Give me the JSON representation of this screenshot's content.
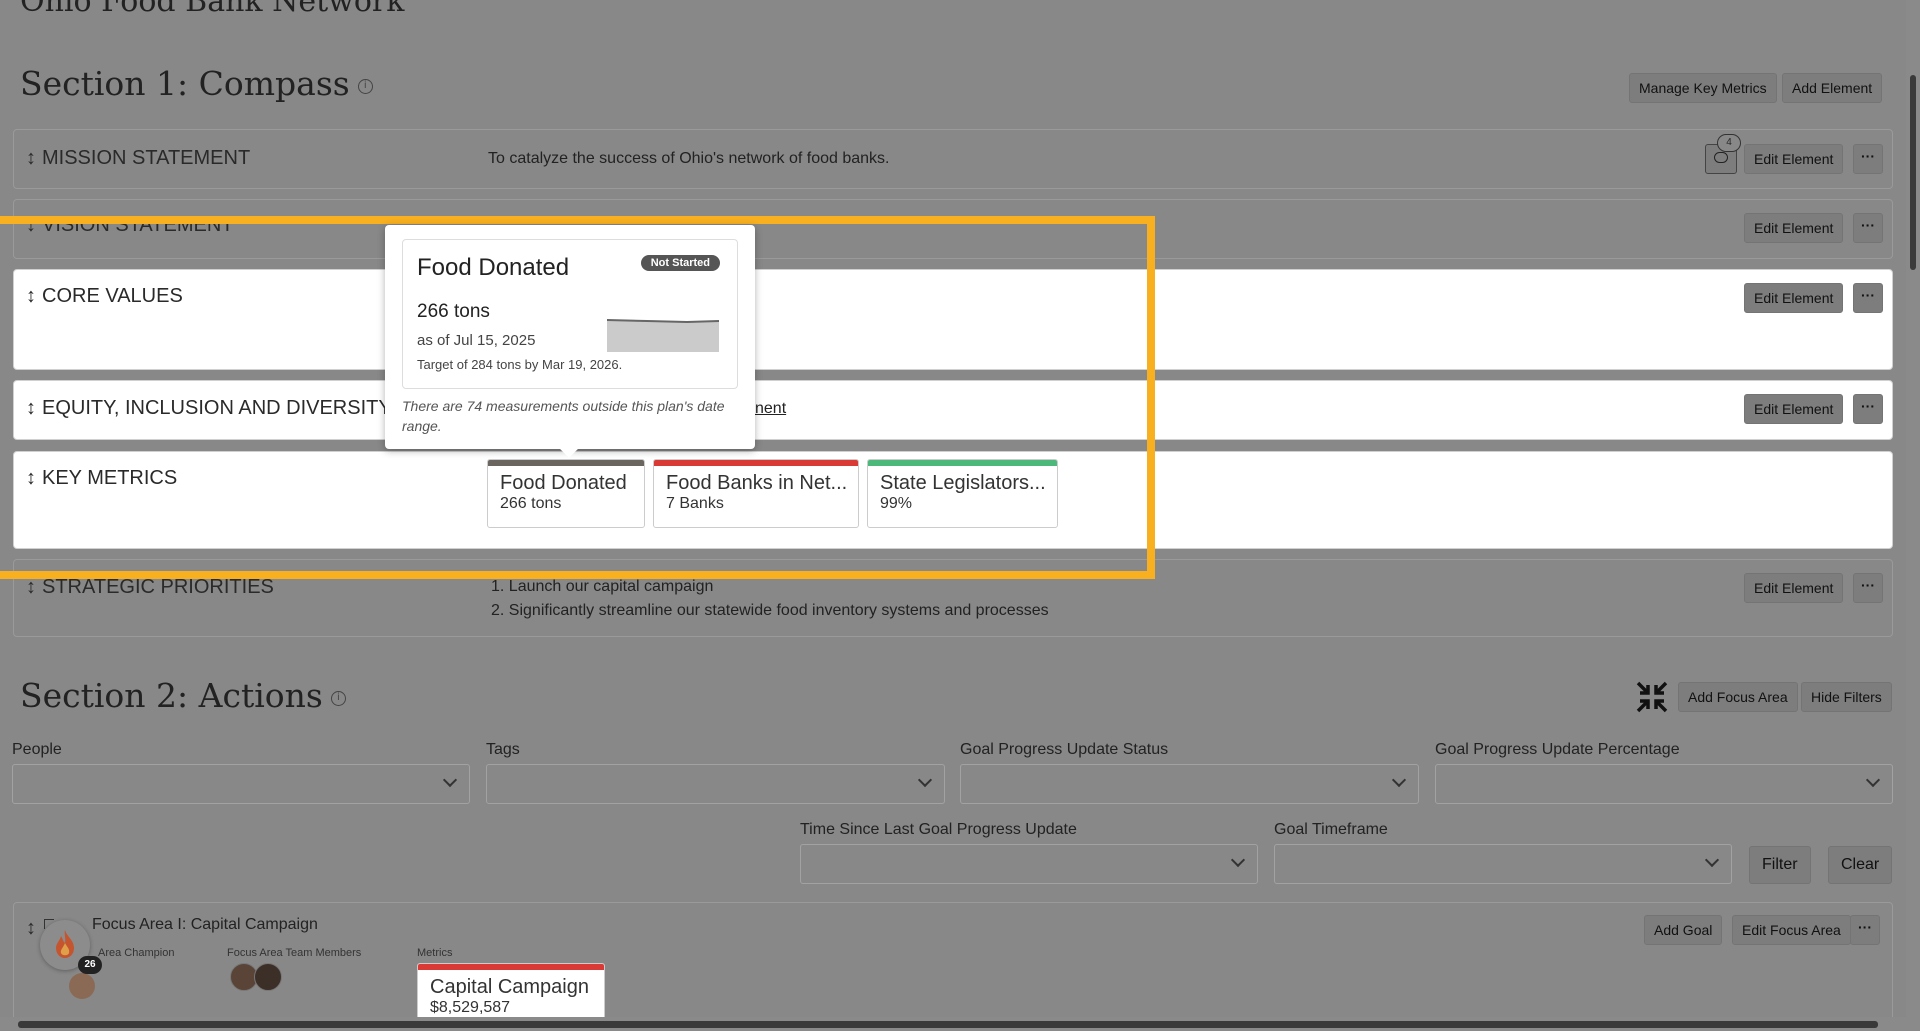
{
  "org": {
    "title": "Ohio Food Bank Network"
  },
  "section1": {
    "title": "Section 1: Compass",
    "info": "i",
    "manage_label": "Manage Key Metrics",
    "add_label": "Add Element"
  },
  "elements": {
    "mission": {
      "arrow": "↕",
      "title": "MISSION STATEMENT",
      "text": "To catalyze the success of Ohio's network of food banks.",
      "comment_count": "4",
      "edit": "Edit Element",
      "more": "···"
    },
    "vision": {
      "arrow": "↕",
      "title": "VISION STATEMENT",
      "edit": "Edit Element",
      "more": "···"
    },
    "core": {
      "arrow": "↕",
      "title": "CORE VALUES",
      "edit": "Edit Element",
      "more": "···"
    },
    "equity": {
      "arrow": "↕",
      "title": "EQUITY, INCLUSION AND DIVERSITY",
      "link_text": "nent",
      "edit": "Edit Element",
      "more": "···"
    },
    "keymetrics": {
      "arrow": "↕",
      "title": "KEY METRICS"
    },
    "strategic": {
      "arrow": "↕",
      "title": "STRATEGIC PRIORITIES",
      "items": [
        "1. Launch our capital campaign",
        "2. Significantly streamline our statewide food inventory systems and processes"
      ],
      "edit": "Edit Element",
      "more": "···"
    }
  },
  "metrics": [
    {
      "title": "Food Donated",
      "value": "266 tons",
      "color": "#6b6560"
    },
    {
      "title": "Food Banks in Net...",
      "value": "7 Banks",
      "color": "#d93a36"
    },
    {
      "title": "State Legislators...",
      "value": "99%",
      "color": "#4cb87a"
    }
  ],
  "popup": {
    "title": "Food Donated",
    "badge": "Not Started",
    "value": "266 tons",
    "as_of": "as of Jul 15, 2025",
    "target": "Target of 284 tons by Mar 19, 2026.",
    "note": "There are 74 measurements outside this plan's date range."
  },
  "section2": {
    "title": "Section 2: Actions",
    "info": "i",
    "add_focus_label": "Add Focus Area",
    "hide_filters_label": "Hide Filters"
  },
  "filters": {
    "people": "People",
    "tags": "Tags",
    "status": "Goal Progress Update Status",
    "percentage": "Goal Progress Update Percentage",
    "time_since": "Time Since Last Goal Progress Update",
    "timeframe": "Goal Timeframe",
    "filter_btn": "Filter",
    "clear_btn": "Clear"
  },
  "focus_area": {
    "arrow": "↕",
    "title": "Focus Area I: Capital Campaign",
    "champion_label": "Area Champion",
    "team_label": "Focus Area Team Members",
    "metrics_label": "Metrics",
    "add_goal": "Add Goal",
    "edit_focus": "Edit Focus Area",
    "more": "···",
    "streak": "26",
    "metric": {
      "title": "Capital Campaign",
      "value": "$8,529,587",
      "color": "#d93a36"
    }
  }
}
